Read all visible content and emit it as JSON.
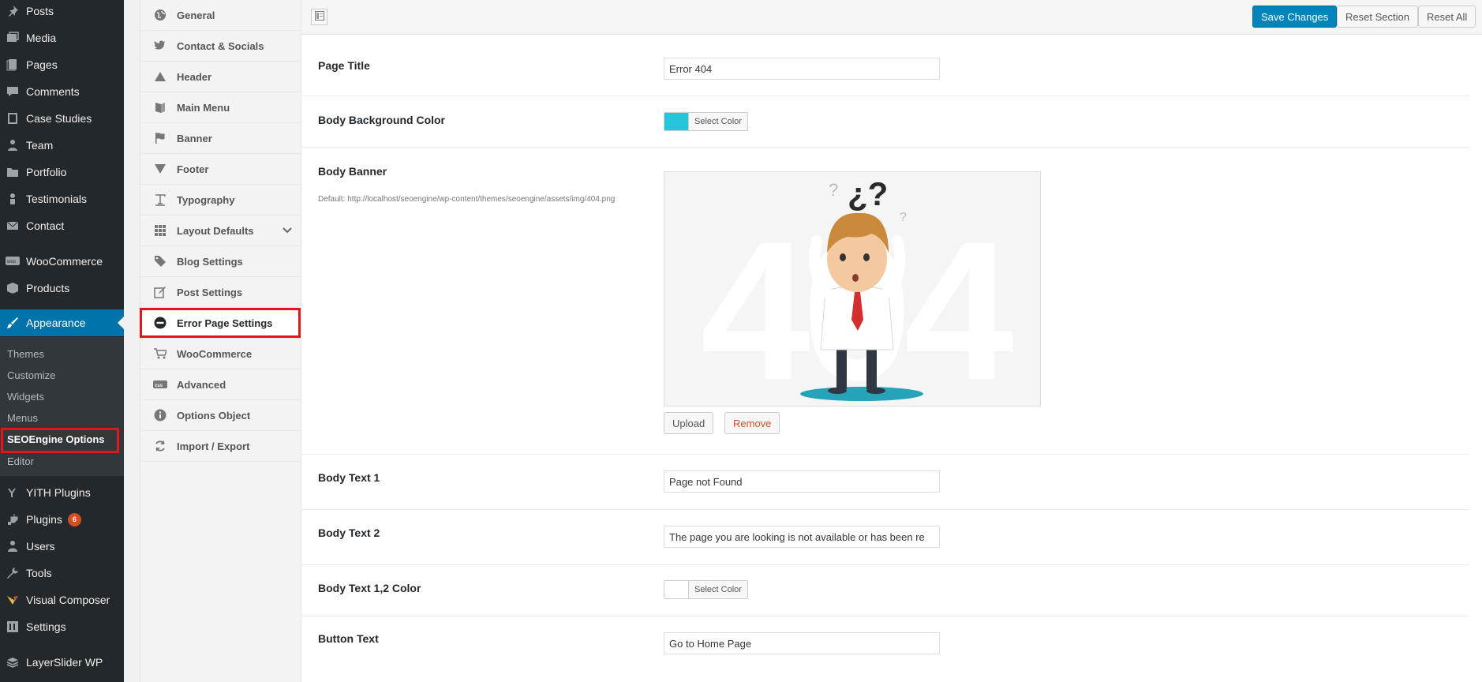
{
  "admin_menu": {
    "top_items": [
      {
        "label": "Posts",
        "icon": "pushpin-icon"
      },
      {
        "label": "Media",
        "icon": "media-icon"
      },
      {
        "label": "Pages",
        "icon": "pages-icon"
      },
      {
        "label": "Comments",
        "icon": "comments-icon"
      },
      {
        "label": "Case Studies",
        "icon": "book-icon"
      },
      {
        "label": "Team",
        "icon": "team-icon"
      },
      {
        "label": "Portfolio",
        "icon": "folder-icon"
      },
      {
        "label": "Testimonials",
        "icon": "testimonials-icon"
      },
      {
        "label": "Contact",
        "icon": "mail-icon"
      },
      {
        "label": "WooCommerce",
        "icon": "woocommerce-icon"
      },
      {
        "label": "Products",
        "icon": "products-icon"
      },
      {
        "label": "Appearance",
        "icon": "brush-icon"
      }
    ],
    "appearance_submenu": [
      "Themes",
      "Customize",
      "Widgets",
      "Menus",
      "SEOEngine Options",
      "Editor"
    ],
    "bottom_items": [
      {
        "label": "YITH Plugins",
        "icon": "yith-icon"
      },
      {
        "label": "Plugins",
        "icon": "plugins-icon",
        "badge": "6"
      },
      {
        "label": "Users",
        "icon": "users-icon"
      },
      {
        "label": "Tools",
        "icon": "tools-icon"
      },
      {
        "label": "Visual Composer",
        "icon": "visual-composer-icon"
      },
      {
        "label": "Settings",
        "icon": "settings-icon"
      },
      {
        "label": "LayerSlider WP",
        "icon": "layerslider-icon"
      }
    ]
  },
  "options_menu": [
    {
      "label": "General",
      "icon": "globe-icon"
    },
    {
      "label": "Contact & Socials",
      "icon": "twitter-icon"
    },
    {
      "label": "Header",
      "icon": "triangle-up-icon"
    },
    {
      "label": "Main Menu",
      "icon": "book-open-icon"
    },
    {
      "label": "Banner",
      "icon": "flag-icon"
    },
    {
      "label": "Footer",
      "icon": "triangle-down-icon"
    },
    {
      "label": "Typography",
      "icon": "text-icon"
    },
    {
      "label": "Layout Defaults",
      "icon": "grid-icon"
    },
    {
      "label": "Blog Settings",
      "icon": "tags-icon"
    },
    {
      "label": "Post Settings",
      "icon": "edit-icon"
    },
    {
      "label": "Error Page Settings",
      "icon": "minus-circle-icon"
    },
    {
      "label": "WooCommerce",
      "icon": "cart-icon"
    },
    {
      "label": "Advanced",
      "icon": "advanced-icon"
    },
    {
      "label": "Options Object",
      "icon": "info-icon"
    },
    {
      "label": "Import / Export",
      "icon": "refresh-icon"
    }
  ],
  "toolbar": {
    "save_label": "Save Changes",
    "reset_section_label": "Reset Section",
    "reset_all_label": "Reset All"
  },
  "fields": {
    "page_title": {
      "label": "Page Title",
      "value": "Error 404"
    },
    "body_bg_color": {
      "label": "Body Background Color",
      "button": "Select Color",
      "color": "#26c6da"
    },
    "body_banner": {
      "label": "Body Banner",
      "description": "Default: http://localhost/seoengine/wp-content/themes/seoengine/assets/img/404.png",
      "upload_label": "Upload",
      "remove_label": "Remove",
      "image_text": "404"
    },
    "body_text_1": {
      "label": "Body Text 1",
      "value": "Page not Found"
    },
    "body_text_2": {
      "label": "Body Text 2",
      "value": "The page you are looking is not available or has been re"
    },
    "body_text_color": {
      "label": "Body Text 1,2 Color",
      "button": "Select Color",
      "color": "#ffffff"
    },
    "button_text": {
      "label": "Button Text",
      "value": "Go to Home Page"
    }
  },
  "colors": {
    "accent": "#0073aa",
    "highlight": "#e3151a",
    "remove": "#d54e21"
  }
}
